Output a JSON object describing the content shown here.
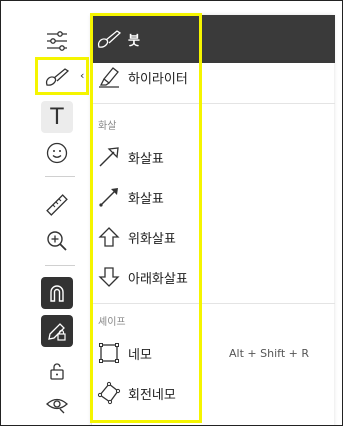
{
  "toolbar": {
    "chevron": "‹",
    "buttons": [
      {
        "name": "sliders-icon"
      },
      {
        "name": "pen-icon"
      },
      {
        "name": "text-icon",
        "glyph": "T"
      },
      {
        "name": "smiley-icon"
      },
      {
        "name": "ruler-icon"
      },
      {
        "name": "zoom-in-icon"
      },
      {
        "name": "magnet-icon"
      },
      {
        "name": "lock-pen-icon"
      },
      {
        "name": "unlock-icon"
      },
      {
        "name": "eye-icon"
      }
    ]
  },
  "menu": {
    "items_top": [
      {
        "label": "붓",
        "icon": "brush-icon",
        "selected": true
      },
      {
        "label": "하이라이터",
        "icon": "highlighter-icon"
      }
    ],
    "section_arrows": "화살",
    "arrows": [
      {
        "label": "화살표",
        "icon": "arrow-icon"
      },
      {
        "label": "화살표",
        "icon": "line-arrow-icon"
      },
      {
        "label": "위화살표",
        "icon": "up-arrow-icon"
      },
      {
        "label": "아래화살표",
        "icon": "down-arrow-icon"
      }
    ],
    "section_shapes": "셰이프",
    "shapes": [
      {
        "label": "네모",
        "icon": "rectangle-icon",
        "shortcut": "Alt + Shift + R"
      },
      {
        "label": "회전네모",
        "icon": "rotated-rectangle-icon"
      }
    ]
  },
  "colors": {
    "highlight": "#f5f500",
    "selected_bg": "#3a3a3a",
    "dark_button": "#333333"
  }
}
